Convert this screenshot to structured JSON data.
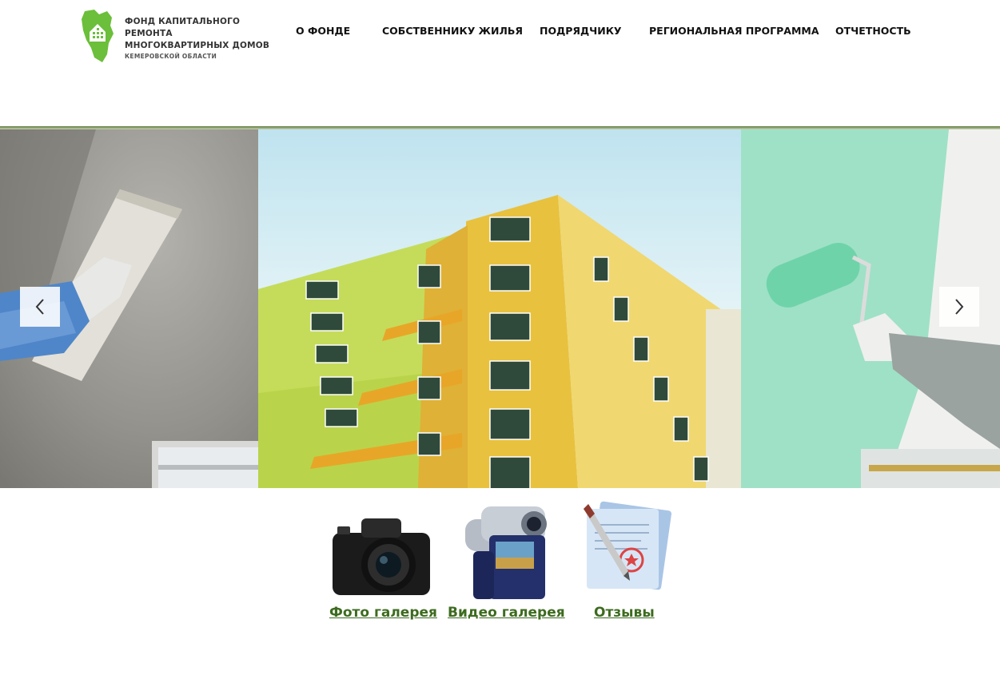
{
  "logo": {
    "line1": "ФОНД КАПИТАЛЬНОГО РЕМОНТА",
    "line2": "МНОГОКВАРТИРНЫХ ДОМОВ",
    "line3": "КЕМЕРОВСКОЙ ОБЛАСТИ",
    "icon": "region-house-logo",
    "color": "#6bbf3a"
  },
  "nav": {
    "items": [
      {
        "label": "О ФОНДЕ"
      },
      {
        "label": "СОБСТВЕННИКУ ЖИЛЬЯ"
      },
      {
        "label": "ПОДРЯДЧИКУ"
      },
      {
        "label": "РЕГИОНАЛЬНАЯ ПРОГРАММА"
      },
      {
        "label": "ОТЧЕТНОСТЬ"
      }
    ]
  },
  "slider": {
    "prev_icon": "chevron-left-icon",
    "next_icon": "chevron-right-icon",
    "slides": [
      "plastering-wall-photo",
      "apartment-building-photo",
      "painting-roller-photo"
    ]
  },
  "gallery": {
    "photo": {
      "label": "Фото галерея",
      "icon": "camera-icon"
    },
    "video": {
      "label": "Видео галерея",
      "icon": "video-camera-icon"
    },
    "reviews": {
      "label": "Отзывы",
      "icon": "document-pen-icon"
    }
  },
  "colors": {
    "link": "#3d6b1f",
    "accent": "#6bbf3a"
  }
}
